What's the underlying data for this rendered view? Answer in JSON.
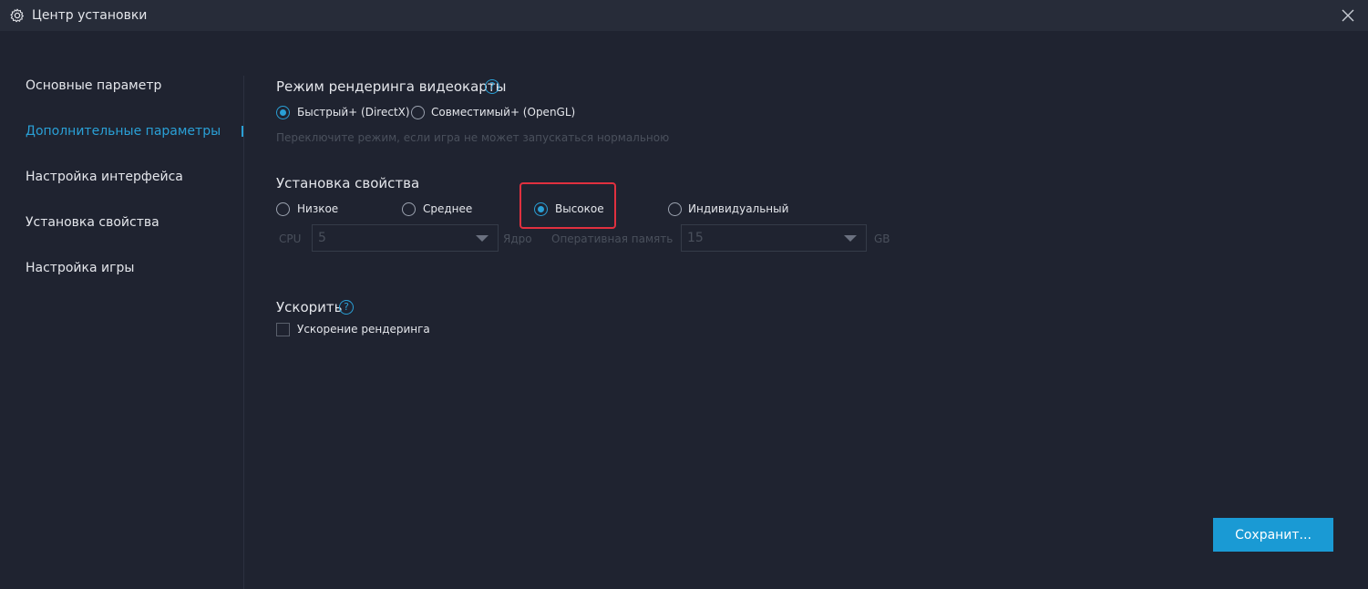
{
  "window": {
    "title": "Центр установки",
    "title_icon": "gear-icon",
    "close_icon": "close-icon"
  },
  "sidebar": {
    "items": [
      {
        "label": "Основные параметр",
        "active": false
      },
      {
        "label": "Дополнительные параметры",
        "active": true
      },
      {
        "label": "Настройка интерфейса",
        "active": false
      },
      {
        "label": "Установка свойства",
        "active": false
      },
      {
        "label": "Настройка игры",
        "active": false
      }
    ]
  },
  "render_mode": {
    "title": "Режим рендеринга видеокарты",
    "help_icon": "question-icon",
    "options": [
      {
        "label": "Быстрый+ (DirectX)",
        "checked": true
      },
      {
        "label": "Совместимый+ (OpenGL)",
        "checked": false
      }
    ],
    "hint": "Переключите режим, если игра не может запускаться нормальною"
  },
  "performance": {
    "title": "Установка свойства",
    "options": [
      {
        "label": "Низкое",
        "checked": false
      },
      {
        "label": "Среднее",
        "checked": false
      },
      {
        "label": "Высокое",
        "checked": true
      },
      {
        "label": "Индивидуальный",
        "checked": false
      }
    ],
    "cpu_label": "CPU",
    "cpu_value": "5",
    "cpu_unit": "Ядро",
    "memory_label": "Оперативная память",
    "memory_value": "15",
    "memory_unit": "GB"
  },
  "accelerate": {
    "title": "Ускорить",
    "help_icon": "question-icon",
    "checkbox_label": "Ускорение рендеринга",
    "checked": false
  },
  "footer": {
    "save_label": "Сохранит..."
  },
  "colors": {
    "accent": "#2aa0d6",
    "button": "#1a9ad4",
    "highlight": "#e0303f",
    "background": "#1f2330",
    "titlebar": "#272c39"
  }
}
